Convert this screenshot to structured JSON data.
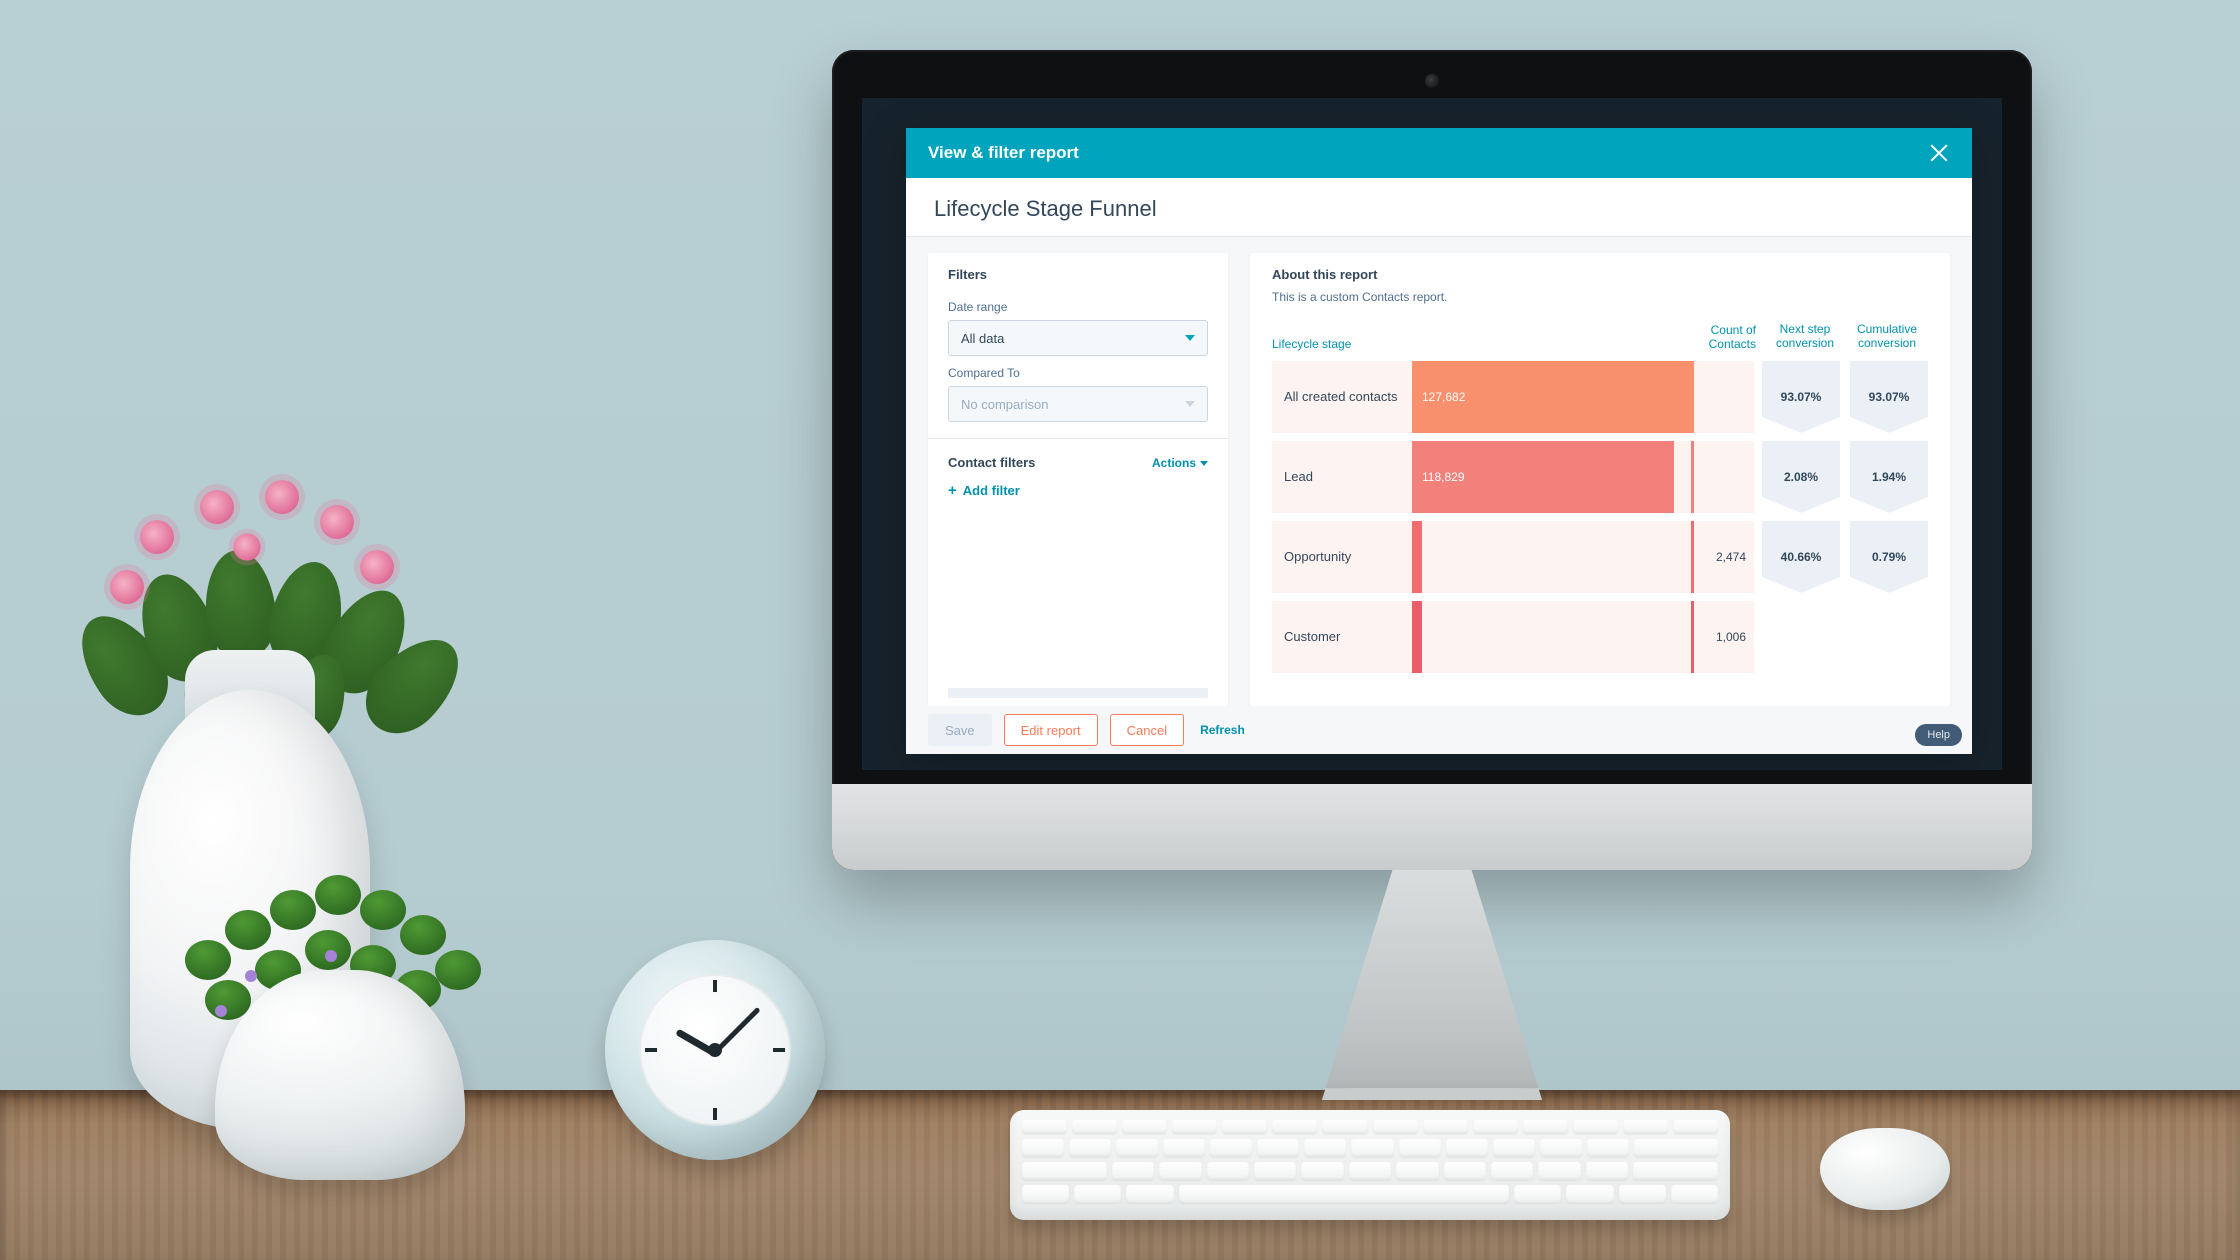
{
  "modal": {
    "header_title": "View & filter report",
    "page_title": "Lifecycle Stage Funnel",
    "filters": {
      "section_title": "Filters",
      "date_range_label": "Date range",
      "date_range_value": "All data",
      "compared_to_label": "Compared To",
      "compared_to_value": "No comparison",
      "contact_filters_title": "Contact filters",
      "actions_label": "Actions",
      "add_filter_label": "Add filter"
    },
    "about": {
      "section_title": "About this report",
      "description": "This is a custom Contacts report."
    },
    "footer": {
      "save": "Save",
      "edit": "Edit report",
      "cancel": "Cancel",
      "refresh": "Refresh",
      "help": "Help"
    }
  },
  "chart_data": {
    "type": "bar",
    "title": "Lifecycle Stage Funnel",
    "columns": {
      "stage": "Lifecycle stage",
      "count": "Count of Contacts",
      "next": "Next step conversion",
      "cum": "Cumulative conversion"
    },
    "max_value": 127682,
    "rows": [
      {
        "stage": "All created contacts",
        "count": 127682,
        "count_label": "127,682",
        "count_inside": true,
        "next": "93.07%",
        "cum": "93.07%",
        "color": "#f88f6d",
        "tick": "#f88f6d"
      },
      {
        "stage": "Lead",
        "count": 118829,
        "count_label": "118,829",
        "count_inside": true,
        "next": "2.08%",
        "cum": "1.94%",
        "color": "#f2807b",
        "tick": "#f2807b"
      },
      {
        "stage": "Opportunity",
        "count": 2474,
        "count_label": "2,474",
        "count_inside": false,
        "next": "40.66%",
        "cum": "0.79%",
        "color": "#ef6e6e",
        "tick": "#ef6e6e"
      },
      {
        "stage": "Customer",
        "count": 1006,
        "count_label": "1,006",
        "count_inside": false,
        "next": "",
        "cum": "",
        "color": "#ea5e6a",
        "tick": "#ea5e6a"
      }
    ]
  }
}
